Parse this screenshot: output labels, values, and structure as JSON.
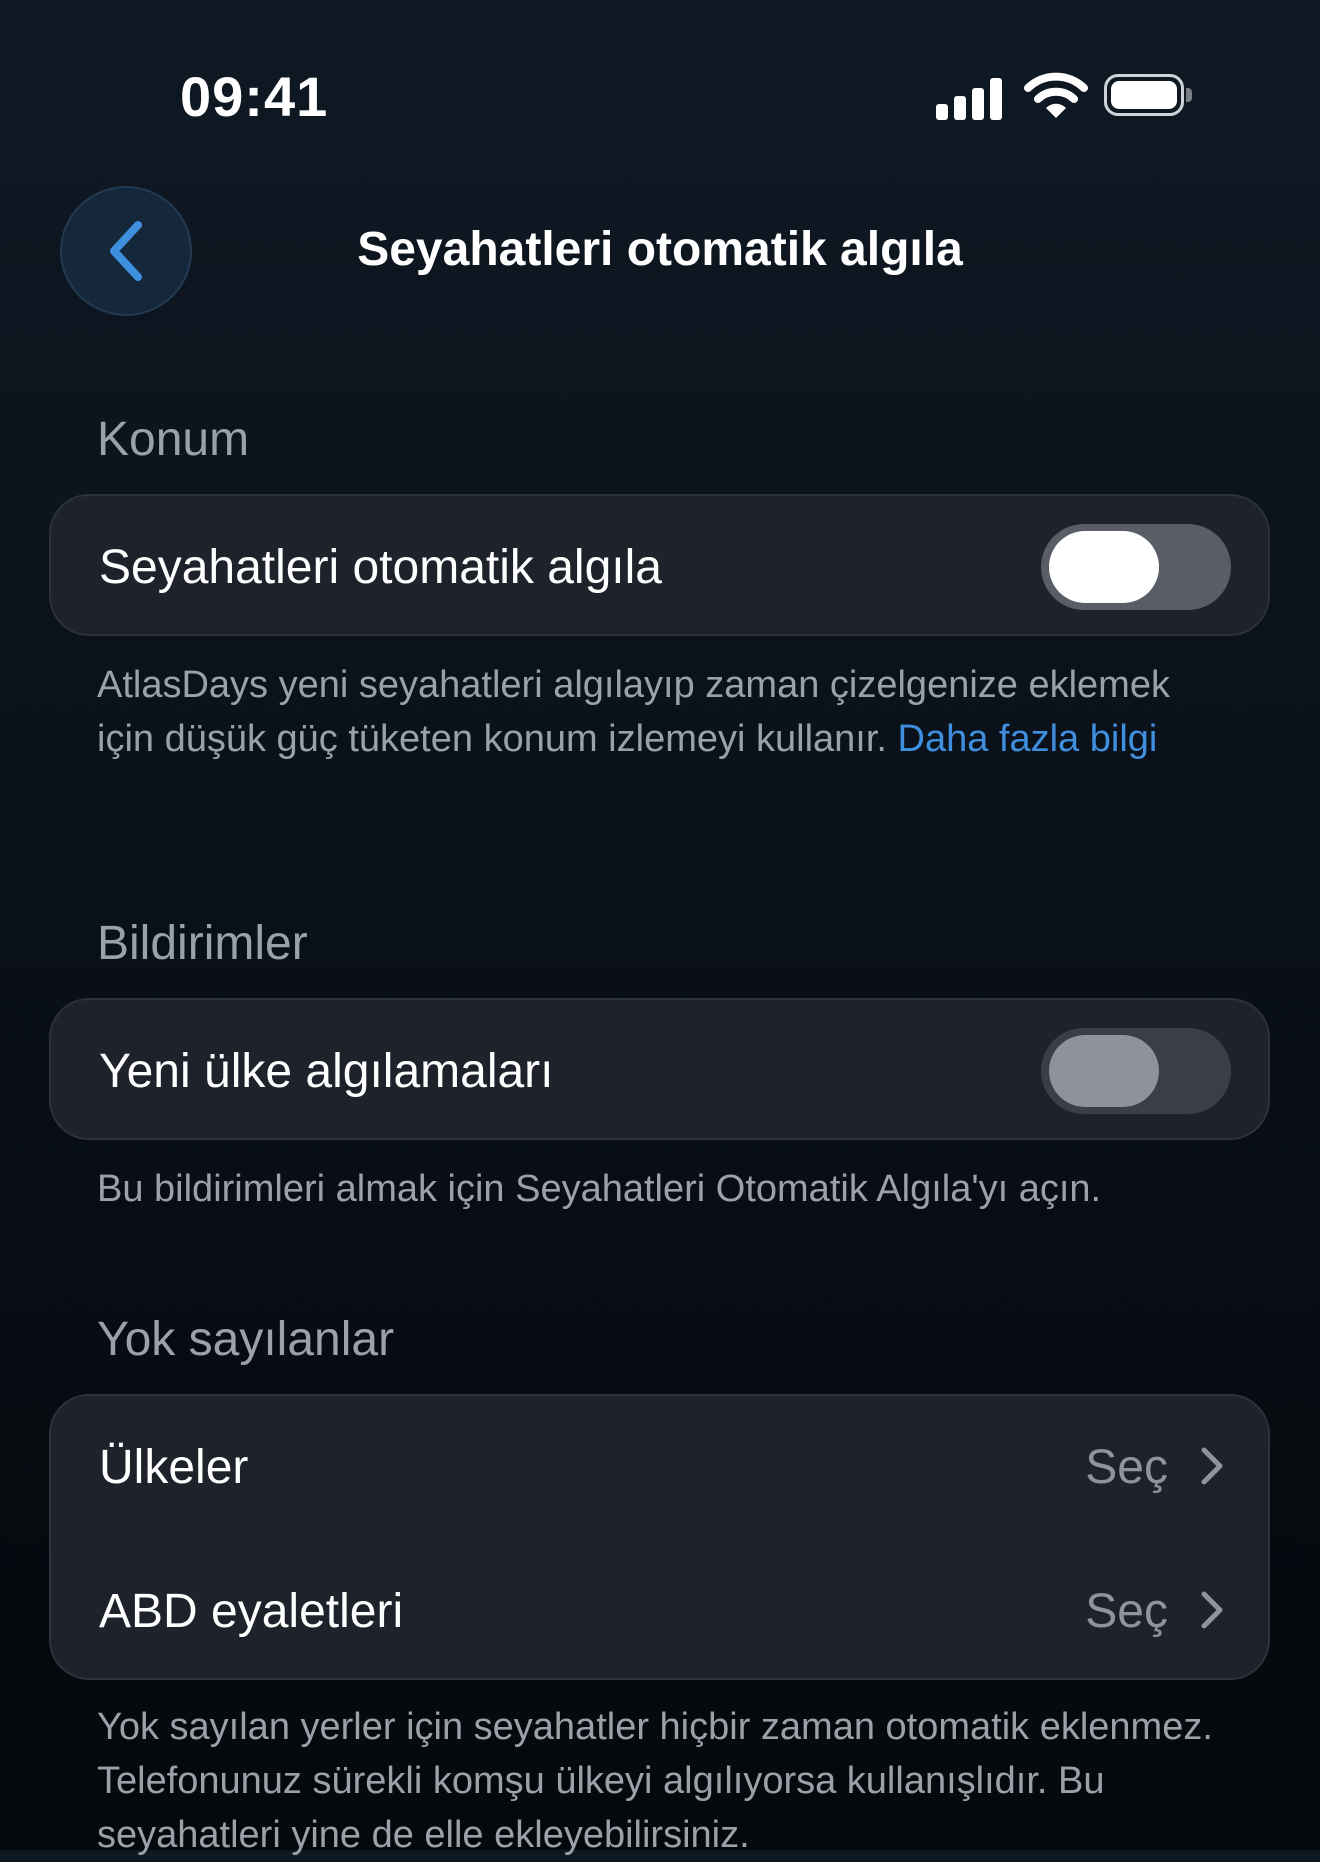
{
  "status_bar": {
    "time": "09:41",
    "icons": [
      "cellular-signal-icon",
      "wifi-icon",
      "battery-icon"
    ]
  },
  "header": {
    "title": "Seyahatleri otomatik algıla",
    "back_icon": "chevron-left-icon",
    "accent_color": "#3f8fdf"
  },
  "sections": {
    "location": {
      "title": "Konum",
      "row_label": "Seyahatleri otomatik algıla",
      "toggle_on": true,
      "footnote_text": "AtlasDays yeni seyahatleri algılayıp zaman çizelgenize eklemek için düşük güç tüketen konum izlemeyi kullanır. ",
      "footnote_link": "Daha fazla bilgi"
    },
    "notifications": {
      "title": "Bildirimler",
      "row_label": "Yeni ülke algılamaları",
      "toggle_on": false,
      "footnote_text": "Bu bildirimleri almak için Seyahatleri Otomatik Algıla'yı açın."
    },
    "excluded": {
      "title": "Yok sayılanlar",
      "rows": [
        {
          "label": "Ülkeler",
          "value": "Seç"
        },
        {
          "label": "ABD eyaletleri",
          "value": "Seç"
        }
      ],
      "footnote_text": "Yok sayılan yerler için seyahatler hiçbir zaman otomatik eklenmez. Telefonunuz sürekli komşu ülkeyi algılıyorsa kullanışlıdır. Bu seyahatleri yine de elle ekleyebilirsiniz."
    }
  }
}
